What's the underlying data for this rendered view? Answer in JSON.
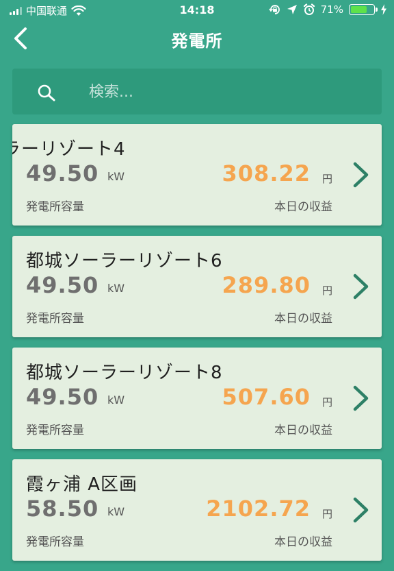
{
  "status_bar": {
    "carrier": "中国联通",
    "time": "14:18",
    "battery_percent": "71%",
    "battery_level": 0.71,
    "icons": [
      "signal-icon",
      "wifi-icon",
      "lock-rotation-icon",
      "location-arrow-icon",
      "alarm-icon",
      "battery-icon",
      "charging-icon"
    ]
  },
  "header": {
    "title": "発電所",
    "back_icon": "chevron-left-icon"
  },
  "search": {
    "placeholder": "検索...",
    "value": "",
    "icon": "search-icon"
  },
  "labels": {
    "capacity_unit": "kW",
    "revenue_unit": "円",
    "capacity_label": "発電所容量",
    "revenue_label": "本日の収益"
  },
  "plants": [
    {
      "name": "ラーリゾート4",
      "capacity": "49.50",
      "revenue": "308.22"
    },
    {
      "name": "都城ソーラーリゾート6",
      "capacity": "49.50",
      "revenue": "289.80"
    },
    {
      "name": "都城ソーラーリゾート8",
      "capacity": "49.50",
      "revenue": "507.60"
    },
    {
      "name": "霞ヶ浦 A区画",
      "capacity": "58.50",
      "revenue": "2102.72"
    }
  ],
  "colors": {
    "background": "#38a68a",
    "search_bg": "#2e9a7c",
    "card_bg": "#e4efe0",
    "revenue": "#f5a54f",
    "capacity": "#6f6f6f",
    "chevron": "#2d8066",
    "battery": "#5ee24b"
  }
}
